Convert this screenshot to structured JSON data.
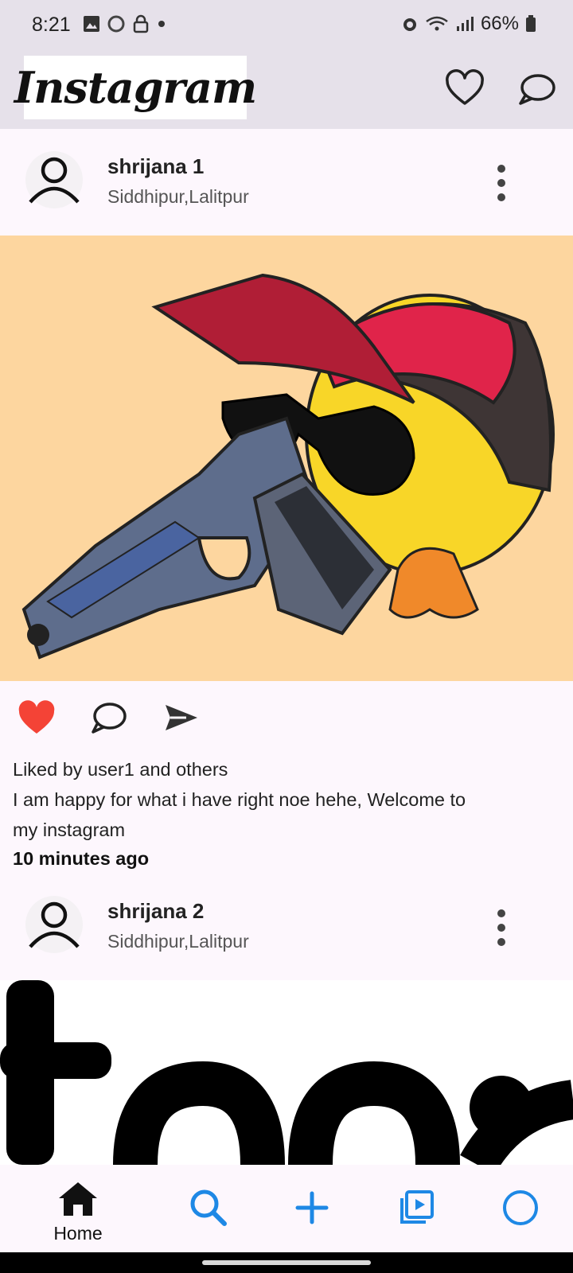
{
  "status": {
    "time": "8:21",
    "battery": "66%"
  },
  "app": {
    "logo": "Instagram"
  },
  "posts": [
    {
      "username": "shrijana 1",
      "location": "Siddhipur,Lalitpur",
      "liked_by": "Liked by user1 and others",
      "caption_line1": "I am happy for what i have right noe hehe, Welcome to",
      "caption_line2": "my instagram",
      "time_ago": "10  minutes ago"
    },
    {
      "username": "shrijana 2",
      "location": "Siddhipur,Lalitpur"
    }
  ],
  "nav": {
    "home_label": "Home"
  },
  "icons": {
    "header": [
      "heart-icon",
      "chat-bubble-icon"
    ],
    "actions": [
      "heart-filled-icon",
      "comment-icon",
      "send-icon"
    ],
    "nav": [
      "home-icon",
      "search-icon",
      "add-icon",
      "reels-icon",
      "profile-icon"
    ]
  },
  "colors": {
    "like": "#f44336",
    "nav_accent": "#1e88e5",
    "appbar": "#e6e1ea",
    "post_bg": "#fdd69f"
  }
}
